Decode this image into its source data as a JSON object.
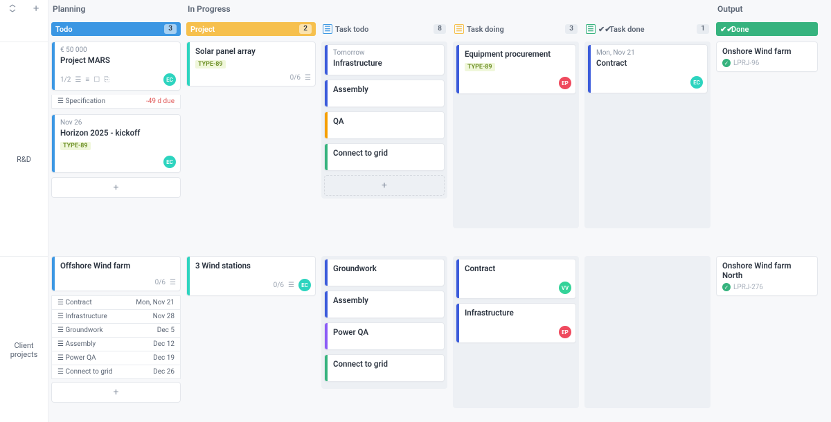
{
  "sections": {
    "planning": "Planning",
    "inprogress": "In Progress",
    "output": "Output"
  },
  "columns": {
    "todo": {
      "label": "Todo",
      "count": "3",
      "color": "#3b97e3"
    },
    "project": {
      "label": "Project",
      "count": "2",
      "color": "#f6c04d"
    },
    "tasktodo": {
      "label": "Task todo",
      "count": "8",
      "iconColor": "#3b97e3"
    },
    "taskdoing": {
      "label": "Task doing",
      "count": "3",
      "iconColor": "#f6c04d"
    },
    "taskdone": {
      "label": "Task done",
      "count": "1",
      "iconColor": "#36b37e"
    },
    "done": {
      "label": "Done",
      "color": "#36b37e"
    }
  },
  "lanes": {
    "rd": "R&D",
    "client": "Client projects"
  },
  "avatars": {
    "ec": {
      "initials": "EC",
      "color": "#2dd4bf"
    },
    "ep": {
      "initials": "EP",
      "color": "#ef4a5e"
    },
    "vv": {
      "initials": "VV",
      "color": "#34d399"
    }
  },
  "tags": {
    "type89": "TYPE-89"
  },
  "cards": {
    "mars": {
      "budget": "€ 50 000",
      "title": "Project MARS",
      "progress": "1/2",
      "sub_spec": "Specification",
      "sub_spec_due": "-49 d due"
    },
    "horizon": {
      "date": "Nov 26",
      "title": "Horizon 2025 - kickoff"
    },
    "solar": {
      "title": "Solar panel array",
      "progress": "0/6"
    },
    "offshore": {
      "title": "Offshore Wind farm",
      "progress": "0/6",
      "subs": [
        {
          "label": "Contract",
          "date": "Mon, Nov 21"
        },
        {
          "label": "Infrastructure",
          "date": "Nov 28"
        },
        {
          "label": "Groundwork",
          "date": "Dec 5"
        },
        {
          "label": "Assembly",
          "date": "Dec 12"
        },
        {
          "label": "Power QA",
          "date": "Dec 19"
        },
        {
          "label": "Connect to grid",
          "date": "Dec 26"
        }
      ]
    },
    "windstations": {
      "title": "3 Wind stations",
      "progress": "0/6"
    },
    "tt_infra": {
      "date": "Tomorrow",
      "title": "Infrastructure",
      "stripe": "#3b5bdb"
    },
    "tt_assembly": {
      "title": "Assembly",
      "stripe": "#3b5bdb"
    },
    "tt_qa": {
      "title": "QA",
      "stripe": "#f59f00"
    },
    "tt_grid": {
      "title": "Connect to grid",
      "stripe": "#36b37e"
    },
    "td_equip": {
      "title": "Equipment procurement",
      "stripe": "#3b5bdb"
    },
    "td_contract": {
      "title": "Contract",
      "date": "Mon, Nov 21",
      "stripe": "#3b5bdb"
    },
    "c_ground": {
      "title": "Groundwork",
      "stripe": "#3b5bdb"
    },
    "c_assembly": {
      "title": "Assembly",
      "stripe": "#3b5bdb"
    },
    "c_powerqa": {
      "title": "Power QA",
      "stripe": "#8b5cf6"
    },
    "c_grid": {
      "title": "Connect to grid",
      "stripe": "#36b37e"
    },
    "c_contract": {
      "title": "Contract",
      "stripe": "#3b5bdb"
    },
    "c_infra": {
      "title": "Infrastructure",
      "stripe": "#3b5bdb"
    },
    "done_onshore": {
      "title": "Onshore Wind farm",
      "ref": "LPRJ-96"
    },
    "done_onshore_n": {
      "title": "Onshore Wind farm North",
      "ref": "LPRJ-276"
    }
  }
}
